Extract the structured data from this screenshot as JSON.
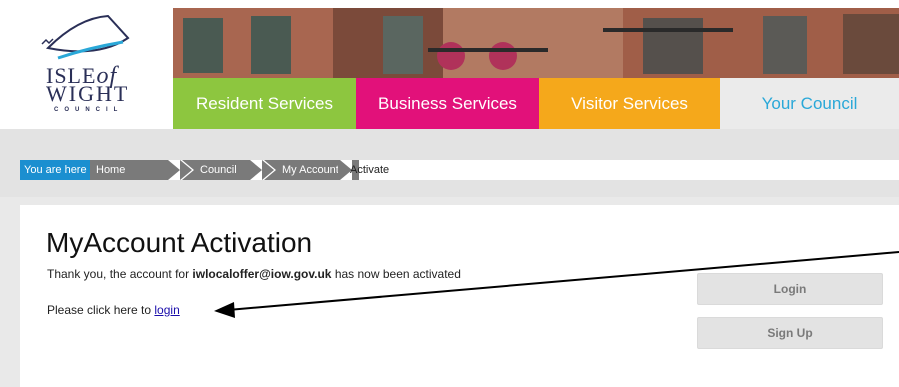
{
  "logo": {
    "line1": "ISLE",
    "line1_of": "of",
    "line2": "WIGHT",
    "line3": "COUNCIL"
  },
  "nav": {
    "tabs": [
      {
        "label": "Resident Services",
        "color": "#8dc63f"
      },
      {
        "label": "Business Services",
        "color": "#e2117a"
      },
      {
        "label": "Visitor Services",
        "color": "#f5a81b"
      },
      {
        "label": "Your Council",
        "color": "#ebebeb"
      }
    ]
  },
  "breadcrumb": {
    "prefix": "You are here",
    "items": [
      "Home",
      "Council",
      "My Account"
    ],
    "current": "Activate"
  },
  "main": {
    "title": "MyAccount Activation",
    "message_pre": "Thank you, the account for ",
    "message_email": "iwlocaloffer@iow.gov.uk",
    "message_post": " has now been activated",
    "login_prompt": "Please click here to ",
    "login_link": "login"
  },
  "sidebar": {
    "login_button": "Login",
    "signup_button": "Sign Up"
  },
  "colors": {
    "accent_blue": "#1b8fd0",
    "link": "#1a0dab"
  }
}
